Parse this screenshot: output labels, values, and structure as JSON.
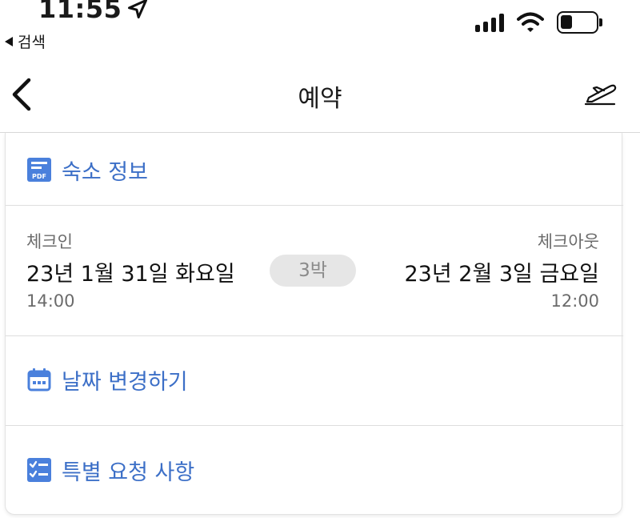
{
  "status_bar": {
    "time": "11:55",
    "back_app_label": "검색",
    "signal_bars": 4,
    "battery_level": 0.3
  },
  "nav": {
    "title": "예약",
    "back_icon": "chevron-left-icon",
    "action_icon": "plane-icon"
  },
  "card": {
    "property_info_label": "숙소 정보",
    "checkin": {
      "label": "체크인",
      "date": "23년 1월 31일 화요일",
      "time": "14:00"
    },
    "nights_badge": "3박",
    "checkout": {
      "label": "체크아웃",
      "date": "23년 2월 3일 금요일",
      "time": "12:00"
    },
    "change_dates_label": "날짜 변경하기",
    "special_requests_label": "특별 요청 사항"
  },
  "colors": {
    "link_blue": "#3c6fc7",
    "icon_blue": "#4a80dc",
    "muted_text": "#6b6b6b",
    "badge_bg": "#e6e6e6"
  }
}
